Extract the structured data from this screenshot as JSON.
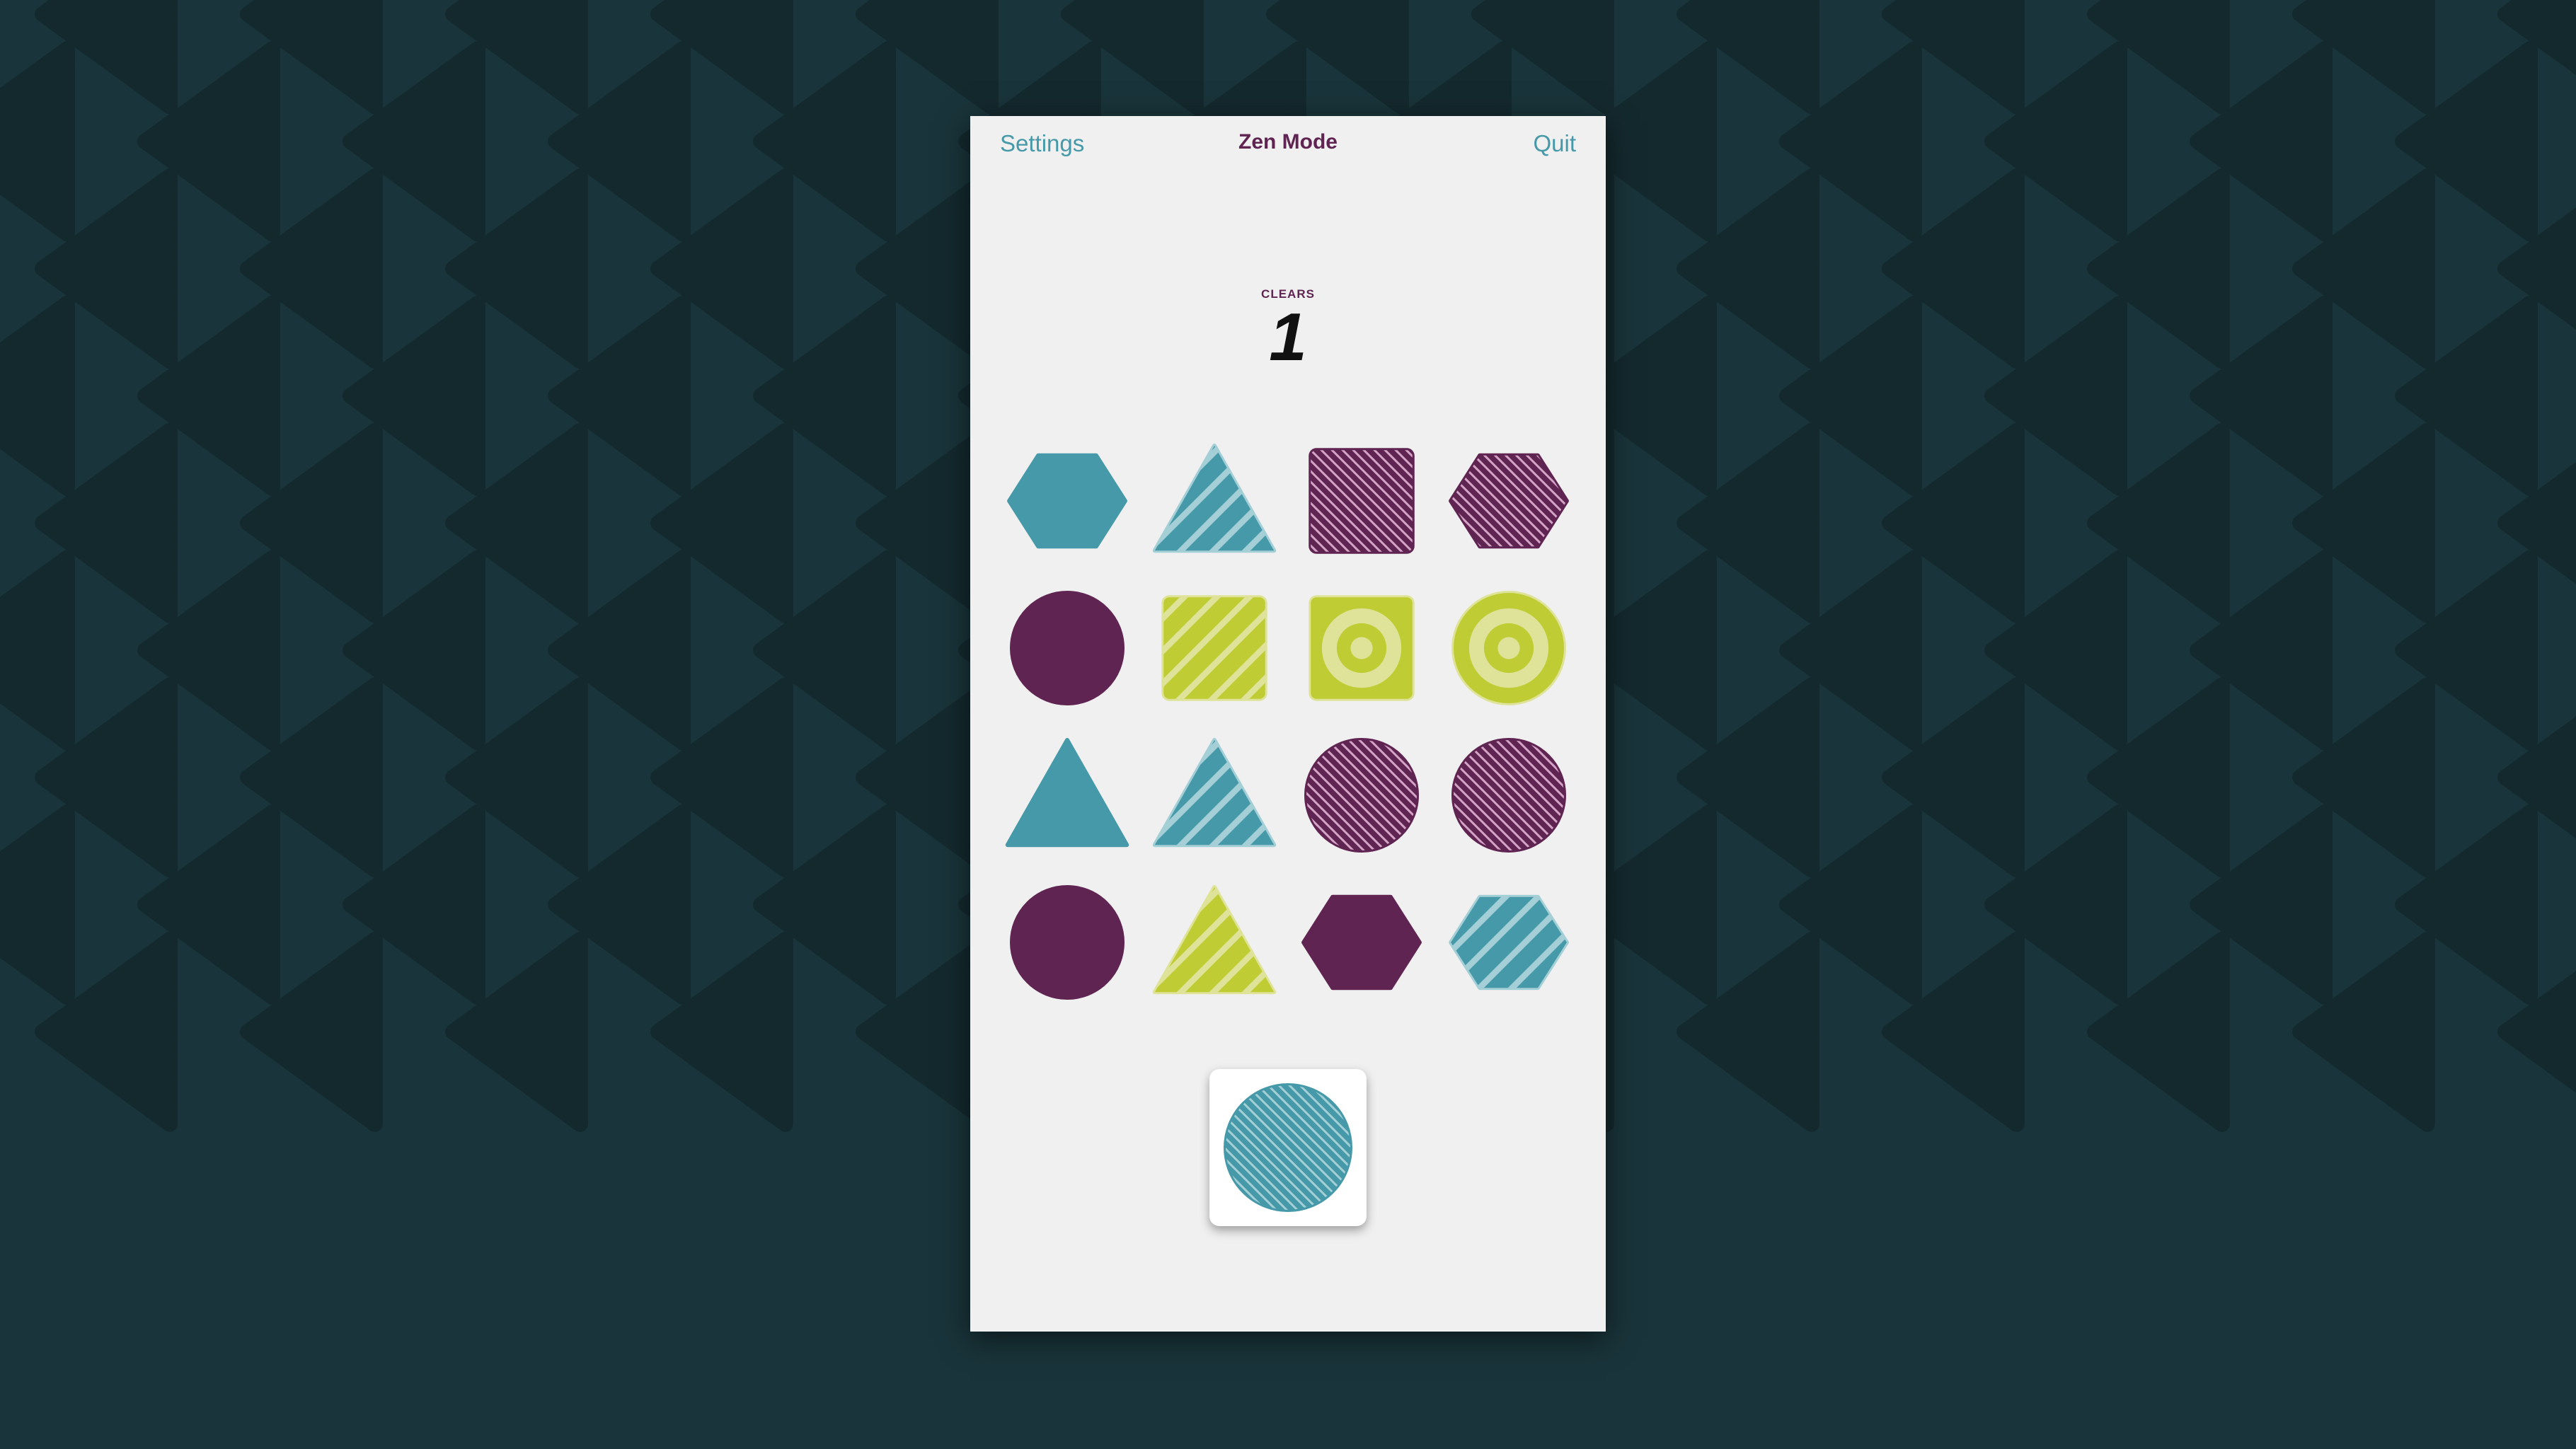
{
  "header": {
    "settings_label": "Settings",
    "title": "Zen Mode",
    "quit_label": "Quit"
  },
  "score": {
    "label": "CLEARS",
    "value": "1"
  },
  "colors": {
    "teal": "#4699a8",
    "teal_light": "#a5cfd7",
    "purple": "#5f2451",
    "purple_light": "#d3a4c6",
    "lime": "#bfcc34",
    "lime_light": "#dfe39a",
    "background": "#19343a",
    "background_shape": "#14292e",
    "panel": "#f0f0f0"
  },
  "board": {
    "rows": 4,
    "cols": 4,
    "tiles": [
      {
        "shape": "hexagon",
        "color": "teal",
        "pattern": "solid"
      },
      {
        "shape": "triangle",
        "color": "teal",
        "pattern": "stripes-wide"
      },
      {
        "shape": "square",
        "color": "purple",
        "pattern": "stripes-thin"
      },
      {
        "shape": "hexagon",
        "color": "purple",
        "pattern": "stripes-thin"
      },
      {
        "shape": "circle",
        "color": "purple",
        "pattern": "solid"
      },
      {
        "shape": "square",
        "color": "lime",
        "pattern": "stripes-wide"
      },
      {
        "shape": "square",
        "color": "lime",
        "pattern": "rings"
      },
      {
        "shape": "circle",
        "color": "lime",
        "pattern": "rings"
      },
      {
        "shape": "triangle",
        "color": "teal",
        "pattern": "solid"
      },
      {
        "shape": "triangle",
        "color": "teal",
        "pattern": "stripes-wide"
      },
      {
        "shape": "circle",
        "color": "purple",
        "pattern": "stripes-thin"
      },
      {
        "shape": "circle",
        "color": "purple",
        "pattern": "stripes-thin"
      },
      {
        "shape": "circle",
        "color": "purple",
        "pattern": "solid"
      },
      {
        "shape": "triangle",
        "color": "lime",
        "pattern": "stripes-wide"
      },
      {
        "shape": "hexagon",
        "color": "purple",
        "pattern": "solid"
      },
      {
        "shape": "hexagon",
        "color": "teal",
        "pattern": "stripes-wide"
      }
    ]
  },
  "next_piece": {
    "shape": "circle",
    "color": "teal",
    "pattern": "stripes-thin"
  }
}
